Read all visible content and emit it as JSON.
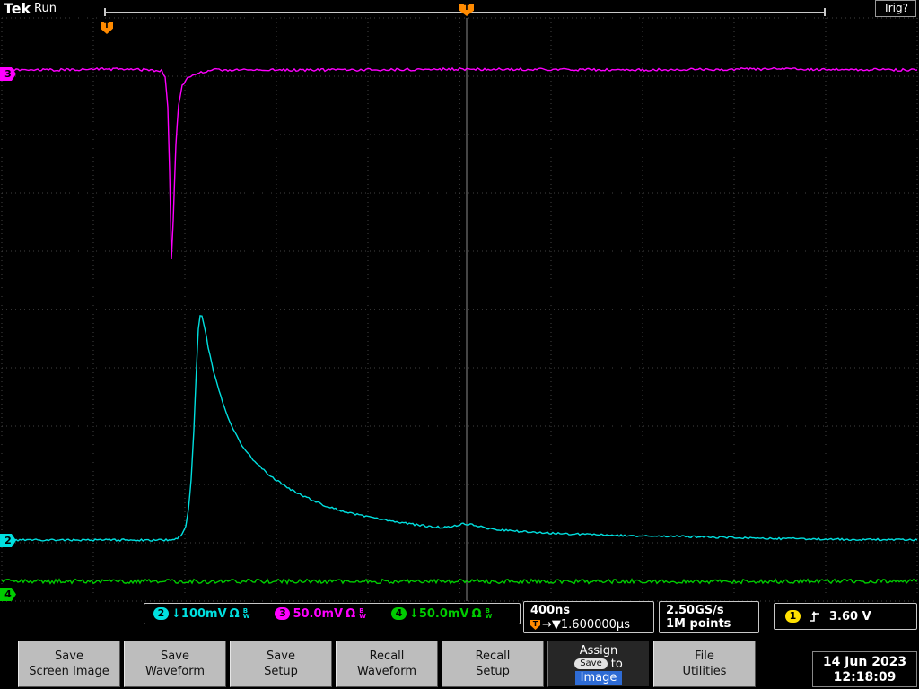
{
  "header": {
    "brand": "Tek",
    "acq_status": "Run",
    "trig_status": "Trig?",
    "trigger_marker": "T",
    "expansion_marker": "T"
  },
  "channel_markers": [
    {
      "label": "3",
      "color": "#ff00ff"
    },
    {
      "label": "2",
      "color": "#00e0e0"
    },
    {
      "label": "4",
      "color": "#00cc00"
    }
  ],
  "readouts": {
    "bw_b": "B",
    "bw_w": "W",
    "channels": [
      {
        "ch": "2",
        "color": "#00e0e0",
        "value": "↓100mV",
        "unit": "Ω"
      },
      {
        "ch": "3",
        "color": "#ff00ff",
        "value": "50.0mV",
        "unit": "Ω"
      },
      {
        "ch": "4",
        "color": "#00cc00",
        "value": "↓50.0mV",
        "unit": "Ω"
      }
    ],
    "timebase": {
      "scale": "400ns",
      "delay_marker": "T",
      "delay": "→▼1.600000µs"
    },
    "acquisition": {
      "rate": "2.50GS/s",
      "record": "1M points"
    },
    "trigger": {
      "source": "1",
      "level": "3.60 V"
    }
  },
  "menu": {
    "buttons": [
      {
        "lines": [
          "Save",
          "Screen Image"
        ]
      },
      {
        "lines": [
          "Save",
          "Waveform"
        ]
      },
      {
        "lines": [
          "Save",
          "Setup"
        ]
      },
      {
        "lines": [
          "Recall",
          "Waveform"
        ]
      },
      {
        "lines": [
          "Recall",
          "Setup"
        ]
      },
      {
        "lines": [
          "File",
          "Utilities"
        ]
      }
    ],
    "assign_button": {
      "line1": "Assign",
      "badge": "Save",
      "mid": "to",
      "target": "Image"
    },
    "datetime": {
      "date": "14 Jun 2023",
      "time": "12:18:09"
    }
  },
  "waveforms": [
    {
      "name": "ch3",
      "color": "#ff00ff",
      "noise": 1.4,
      "seed": 11,
      "points": [
        [
          2,
          78
        ],
        [
          60,
          78
        ],
        [
          120,
          77
        ],
        [
          168,
          78
        ],
        [
          180,
          79
        ],
        [
          184,
          86
        ],
        [
          187,
          120
        ],
        [
          189,
          190
        ],
        [
          191,
          289
        ],
        [
          193,
          245
        ],
        [
          196,
          160
        ],
        [
          199,
          117
        ],
        [
          203,
          96
        ],
        [
          209,
          87
        ],
        [
          218,
          82
        ],
        [
          240,
          78
        ],
        [
          400,
          78
        ],
        [
          520,
          77
        ],
        [
          700,
          78
        ],
        [
          860,
          77
        ],
        [
          1022,
          78
        ]
      ]
    },
    {
      "name": "ch2",
      "color": "#00e0e0",
      "noise": 1.1,
      "seed": 23,
      "points": [
        [
          2,
          602
        ],
        [
          120,
          602
        ],
        [
          185,
          602
        ],
        [
          196,
          601
        ],
        [
          203,
          596
        ],
        [
          207,
          586
        ],
        [
          210,
          568
        ],
        [
          213,
          535
        ],
        [
          216,
          480
        ],
        [
          219,
          408
        ],
        [
          221,
          366
        ],
        [
          223,
          351
        ],
        [
          225,
          352
        ],
        [
          228,
          365
        ],
        [
          232,
          387
        ],
        [
          238,
          414
        ],
        [
          246,
          442
        ],
        [
          256,
          470
        ],
        [
          268,
          494
        ],
        [
          282,
          513
        ],
        [
          298,
          528
        ],
        [
          316,
          541
        ],
        [
          336,
          552
        ],
        [
          358,
          562
        ],
        [
          382,
          570
        ],
        [
          408,
          576
        ],
        [
          436,
          581
        ],
        [
          464,
          585
        ],
        [
          492,
          588
        ],
        [
          505,
          587
        ],
        [
          516,
          584
        ],
        [
          528,
          585
        ],
        [
          542,
          589
        ],
        [
          560,
          591
        ],
        [
          590,
          593
        ],
        [
          630,
          595
        ],
        [
          690,
          597
        ],
        [
          760,
          598
        ],
        [
          840,
          600
        ],
        [
          920,
          601
        ],
        [
          1022,
          602
        ]
      ]
    },
    {
      "name": "ch4",
      "color": "#00cc00",
      "noise": 2.4,
      "seed": 37,
      "points": [
        [
          2,
          648
        ],
        [
          200,
          648
        ],
        [
          400,
          648
        ],
        [
          600,
          648
        ],
        [
          800,
          648
        ],
        [
          1022,
          648
        ]
      ]
    }
  ]
}
